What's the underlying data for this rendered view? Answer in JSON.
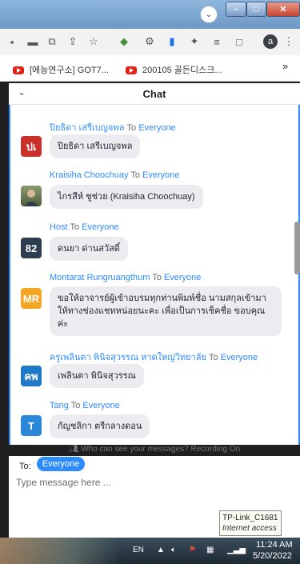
{
  "browser": {
    "bookmarks": [
      {
        "label": "[에능연구소] GOT7..."
      },
      {
        "label": "200105 골든디스크..."
      }
    ],
    "bookmarks_overflow": "»",
    "profile_initial": "a"
  },
  "chat": {
    "title": "Chat",
    "to_word": "To",
    "messages": [
      {
        "sender": "ปิยธิดา เสรีเบญจพล",
        "to": "Everyone",
        "avatar_text": "ปเ",
        "avatar_color": "#c9302c",
        "text": "ปิยธิดา เสรีเบญจพล"
      },
      {
        "sender": "Kraisiha Choochuay",
        "to": "Everyone",
        "avatar_text": "",
        "avatar_color": "#6b7a5a",
        "text": "ไกรสีห์ ชูช่วย (Kraisiha Choochuay)"
      },
      {
        "sender": "Host",
        "to": "Everyone",
        "avatar_text": "82",
        "avatar_color": "#2c3e50",
        "text": "ดนยา ด่านสวัสดิ์"
      },
      {
        "sender": "Montarat Rungruangthum",
        "to": "Everyone",
        "avatar_text": "MR",
        "avatar_color": "#f5a623",
        "text": "ขอให้อาจารย์ผู้เข้าอบรมทุกท่านพิมพ์ชื่อ นามสกุลเข้ามาให้ทางช่องแชทหน่อยนะคะ เพื่อเป็นการเช็คชื่อ ขอบคุณค่ะ"
      },
      {
        "sender": "ครูเพลินตา พินิจสุวรรณ หาดใหญ่วิทยาลัย",
        "to": "Everyone",
        "avatar_text": "คพ",
        "avatar_color": "#1f78c8",
        "text": "เพลินตา พินิจสุวรรณ"
      },
      {
        "sender": "Tang",
        "to": "Everyone",
        "avatar_text": "T",
        "avatar_color": "#2b88d8",
        "text": "กัญชลิกา ตรีกลางดอน"
      }
    ],
    "who_can_see": "Who can see your messages? Recording On",
    "to_label": "To:",
    "recipient": "Everyone",
    "input_placeholder": "Type message here ..."
  },
  "taskbar": {
    "language": "EN",
    "tooltip_network": "TP-Link_C1681",
    "tooltip_status": "Internet access",
    "time": "11:24 AM",
    "date": "5/20/2022"
  }
}
